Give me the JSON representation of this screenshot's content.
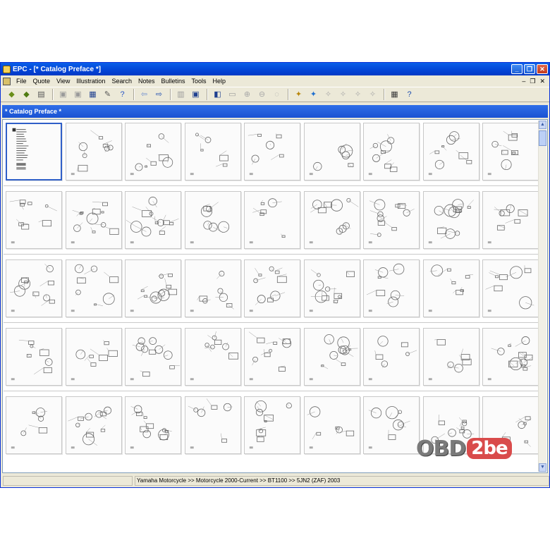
{
  "window": {
    "title": "EPC - [* Catalog Preface *]",
    "controls": {
      "minimize": "_",
      "restore": "❐",
      "close": "✕"
    }
  },
  "menubar": {
    "items": [
      "File",
      "Quote",
      "View",
      "Illustration",
      "Search",
      "Notes",
      "Bulletins",
      "Tools",
      "Help"
    ],
    "mdi": {
      "minimize": "–",
      "restore": "❐",
      "close": "✕"
    }
  },
  "toolbar": {
    "groups": [
      [
        {
          "name": "open-catalog-icon",
          "glyph": "◆",
          "color": "#6a8f1a"
        },
        {
          "name": "open-model-icon",
          "glyph": "◆",
          "color": "#4f7b12"
        },
        {
          "name": "print-icon",
          "glyph": "▤",
          "color": "#555555"
        }
      ],
      [
        {
          "name": "page-icon",
          "glyph": "▣",
          "color": "#9a9a9a"
        },
        {
          "name": "page-setup-icon",
          "glyph": "▣",
          "color": "#9a9a9a"
        },
        {
          "name": "window-icon",
          "glyph": "▦",
          "color": "#1e3f8f"
        },
        {
          "name": "tools-icon",
          "glyph": "✎",
          "color": "#555555"
        },
        {
          "name": "help-cursor-icon",
          "glyph": "?",
          "color": "#2a58c8"
        }
      ],
      [
        {
          "name": "back-arrow-icon",
          "glyph": "⇦",
          "color": "#6f8fd0"
        },
        {
          "name": "forward-arrow-icon",
          "glyph": "⇨",
          "color": "#1f4fb0"
        }
      ],
      [
        {
          "name": "list-view-icon",
          "glyph": "▥",
          "color": "#9a9a9a"
        },
        {
          "name": "thumbnail-view-icon",
          "glyph": "▣",
          "color": "#1e3f8f"
        }
      ],
      [
        {
          "name": "zoom-page-icon",
          "glyph": "◧",
          "color": "#1e3f8f"
        },
        {
          "name": "fit-page-icon",
          "glyph": "▭",
          "color": "#9a9a9a"
        },
        {
          "name": "zoom-in-icon",
          "glyph": "⊕",
          "color": "#a8a8a8"
        },
        {
          "name": "zoom-out-icon",
          "glyph": "⊖",
          "color": "#a8a8a8"
        },
        {
          "name": "zoom-reset-icon",
          "glyph": "◌",
          "color": "#a8a8a8"
        }
      ],
      [
        {
          "name": "parts-tag-icon",
          "glyph": "✦",
          "color": "#b8860b"
        },
        {
          "name": "parts-color-icon",
          "glyph": "✦",
          "color": "#1f6fcf"
        },
        {
          "name": "find-icon",
          "glyph": "✧",
          "color": "#a8a8a8"
        },
        {
          "name": "find-next-icon",
          "glyph": "✧",
          "color": "#a8a8a8"
        },
        {
          "name": "find-prev-icon",
          "glyph": "✧",
          "color": "#a8a8a8"
        },
        {
          "name": "link-icon",
          "glyph": "✧",
          "color": "#a8a8a8"
        }
      ],
      [
        {
          "name": "calculator-icon",
          "glyph": "▦",
          "color": "#3a3a3a"
        },
        {
          "name": "help-icon",
          "glyph": "?",
          "color": "#1f4fb0"
        }
      ]
    ]
  },
  "panel": {
    "title": "* Catalog Preface *"
  },
  "thumbnails": {
    "rows": 5,
    "cols": 9,
    "selected_index": 0
  },
  "status": {
    "breadcrumb": "Yamaha Motorcycle >> Motorcycle 2000-Current >> BT1100 >> 5JN2 (ZAF) 2003"
  },
  "watermark": {
    "left": "OBD",
    "right": "2be"
  }
}
